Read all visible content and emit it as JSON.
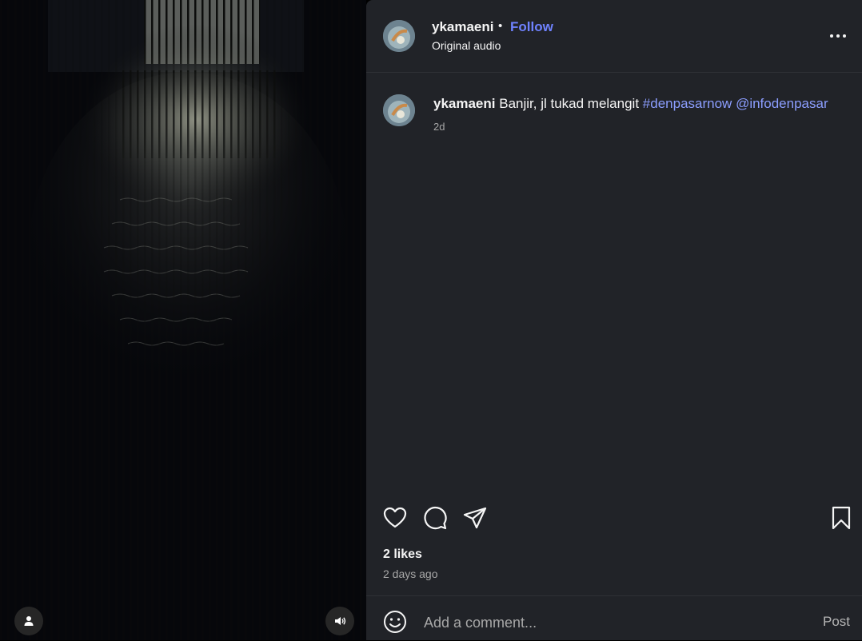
{
  "video": {
    "user_tag_icon": "person-icon",
    "mute_icon": "speaker-icon"
  },
  "header": {
    "username": "ykamaeni",
    "separator": "•",
    "follow_label": "Follow",
    "audio_label": "Original audio",
    "more_icon": "more-horizontal-icon"
  },
  "caption": {
    "username": "ykamaeni",
    "text": "Banjir, jl tukad melangit",
    "hashtag": "#denpasarnow",
    "mention": "@infodenpasar",
    "time": "2d"
  },
  "actions": {
    "like_icon": "heart-icon",
    "comment_icon": "comment-icon",
    "share_icon": "send-icon",
    "save_icon": "bookmark-icon"
  },
  "likes": "2 likes",
  "posted": "2 days ago",
  "comment": {
    "placeholder": "Add a comment...",
    "post_label": "Post",
    "emoji_icon": "emoji-icon"
  },
  "colors": {
    "panel_bg": "#212328",
    "link_blue": "#6f82ff",
    "hashtag_blue": "#8c9eff",
    "muted_text": "#a8a8a8"
  }
}
